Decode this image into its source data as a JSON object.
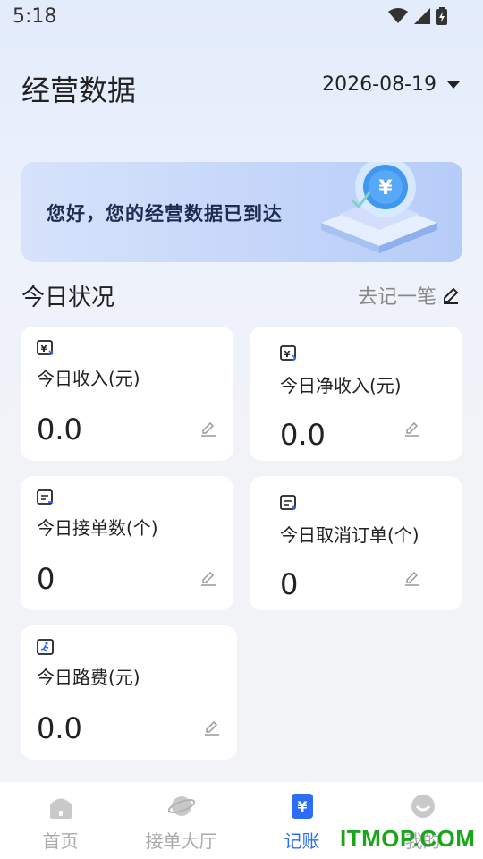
{
  "status_bar": {
    "time": "5:18"
  },
  "header": {
    "title": "经营数据",
    "date": "2026-08-19"
  },
  "banner": {
    "text": "您好，您的经营数据已到达"
  },
  "section": {
    "title": "今日状况",
    "record_link": "去记一笔"
  },
  "cards": [
    {
      "label": "今日收入(元)",
      "value": "0.0",
      "icon": "income-icon"
    },
    {
      "label": "今日净收入(元)",
      "value": "0.0",
      "icon": "net-income-icon"
    },
    {
      "label": "今日接单数(个)",
      "value": "0",
      "icon": "orders-icon"
    },
    {
      "label": "今日取消订单(个)",
      "value": "0",
      "icon": "cancel-orders-icon"
    },
    {
      "label": "今日路费(元)",
      "value": "0.0",
      "icon": "road-fee-icon"
    }
  ],
  "tabbar": {
    "items": [
      {
        "label": "首页",
        "icon": "home-icon"
      },
      {
        "label": "接单大厅",
        "icon": "planet-icon"
      },
      {
        "label": "记账",
        "icon": "yuan-icon"
      },
      {
        "label": "我的",
        "icon": "profile-icon"
      }
    ],
    "active": 2,
    "accent": "#2d6df6"
  },
  "watermark": "ITMOP.COM"
}
